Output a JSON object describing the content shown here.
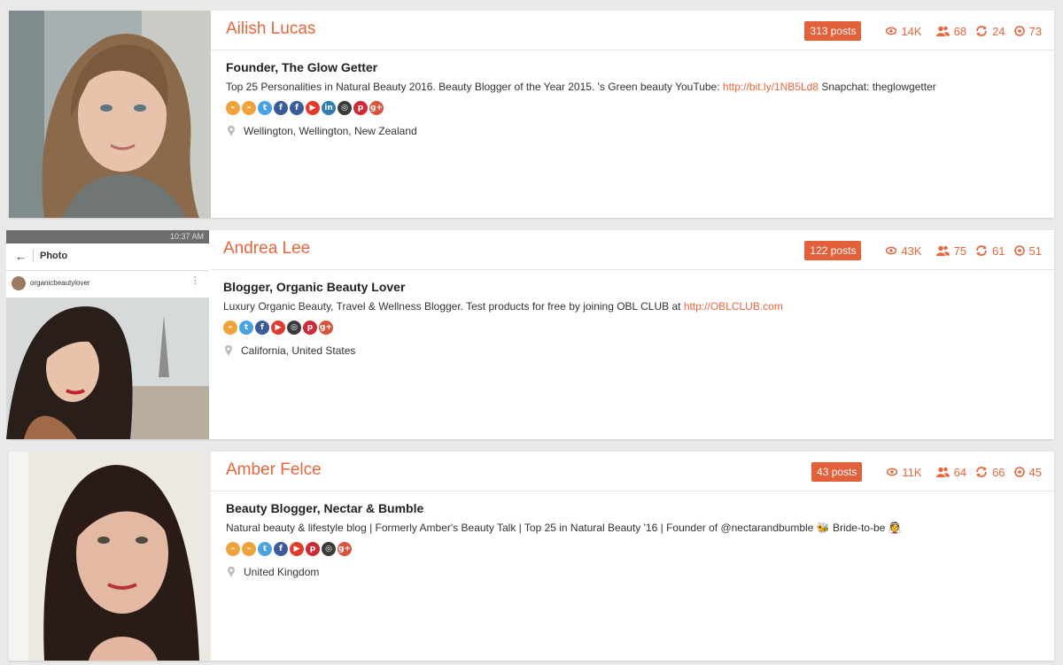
{
  "profiles": [
    {
      "name": "Ailish Lucas",
      "posts": "313 posts",
      "views": "14K",
      "followers": "68",
      "shares": "24",
      "reach": "73",
      "title": "Founder, The Glow Getter",
      "desc_text": "Top 25 Personalities in Natural Beauty 2016. Beauty Blogger of the Year 2015. 's Green beauty YouTube: ",
      "desc_link": "http://bit.ly/1NB5Ld8",
      "desc_after": " Snapchat: theglowgetter",
      "socials": [
        "rss-icon",
        "rss-icon",
        "twitter-icon",
        "facebook-icon",
        "facebook-icon",
        "youtube-icon",
        "linkedin-icon",
        "instagram-icon",
        "pinterest-icon",
        "google-plus-icon"
      ],
      "location": "Wellington, Wellington, New Zealand"
    },
    {
      "name": "Andrea Lee",
      "posts": "122 posts",
      "views": "43K",
      "followers": "75",
      "shares": "61",
      "reach": "51",
      "title": "Blogger, Organic Beauty Lover",
      "desc_text": "Luxury Organic Beauty, Travel & Wellness Blogger. Test products for free by joining OBL CLUB at ",
      "desc_link": "http://OBLCLUB.com",
      "desc_after": "",
      "socials": [
        "rss-icon",
        "twitter-icon",
        "facebook-icon",
        "youtube-icon",
        "instagram-icon",
        "pinterest-icon",
        "google-plus-icon"
      ],
      "location": "California, United States",
      "photo_status": "10:37 AM",
      "photo_header": "Photo",
      "photo_account": "organicbeautylover"
    },
    {
      "name": "Amber Felce",
      "posts": "43 posts",
      "views": "11K",
      "followers": "64",
      "shares": "66",
      "reach": "45",
      "title": "Beauty Blogger, Nectar & Bumble",
      "desc_text": "Natural beauty & lifestyle blog | Formerly Amber's Beauty Talk | Top 25 in Natural Beauty '16 | Founder of @nectarandbumble 🐝 Bride-to-be 👰",
      "desc_link": "",
      "desc_after": "",
      "socials": [
        "rss-icon",
        "rss-icon",
        "twitter-icon",
        "facebook-icon",
        "youtube-icon",
        "pinterest-icon",
        "instagram-icon",
        "google-plus-icon"
      ],
      "location": "United Kingdom"
    }
  ],
  "colors": {
    "accent": "#e8663c",
    "badge": "#e2603a",
    "rss": "#f0a23b",
    "twitter": "#4aa3e0",
    "facebook": "#3b5b9a",
    "youtube": "#e23b2e",
    "linkedin": "#2f7cb5",
    "instagram": "#3a3a3a",
    "pinterest": "#cc2a36",
    "google_plus": "#d9533e"
  }
}
